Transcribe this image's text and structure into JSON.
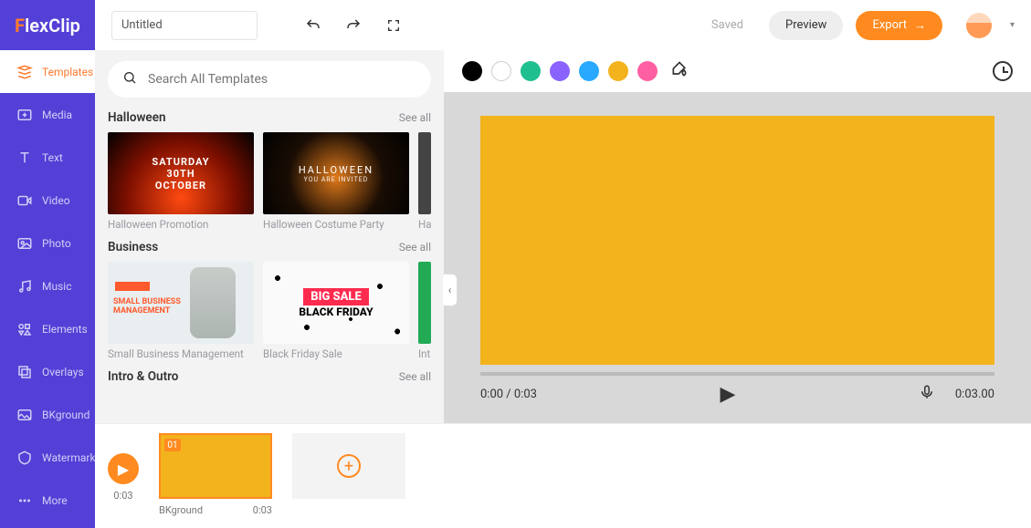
{
  "logo": {
    "f": "F",
    "rest": "lexClip"
  },
  "sidebar": {
    "items": [
      {
        "label": "Templates"
      },
      {
        "label": "Media"
      },
      {
        "label": "Text"
      },
      {
        "label": "Video"
      },
      {
        "label": "Photo"
      },
      {
        "label": "Music"
      },
      {
        "label": "Elements"
      },
      {
        "label": "Overlays"
      },
      {
        "label": "BKground"
      },
      {
        "label": "Watermark"
      },
      {
        "label": "More"
      }
    ]
  },
  "topbar": {
    "title_value": "Untitled",
    "saved_label": "Saved",
    "preview_label": "Preview",
    "export_label": "Export"
  },
  "search": {
    "placeholder": "Search All Templates"
  },
  "sections": {
    "see_all": "See all",
    "halloween": {
      "title": "Halloween",
      "cards": [
        {
          "label": "Halloween Promotion",
          "line1": "SATURDAY",
          "line2": "30TH",
          "line3": "OCTOBER"
        },
        {
          "label": "Halloween Costume Party",
          "line1": "HALLOWEEN",
          "line2": "YOU ARE INVITED"
        },
        {
          "label": "Ha"
        }
      ]
    },
    "business": {
      "title": "Business",
      "cards": [
        {
          "label": "Small Business Management",
          "line1": "SMALL BUSINESS",
          "line2": "MANAGEMENT"
        },
        {
          "label": "Black Friday Sale",
          "line1": "BIG SALE",
          "line2": "BLACK FRIDAY"
        },
        {
          "label": "Int"
        }
      ]
    },
    "intro": {
      "title": "Intro & Outro"
    }
  },
  "swatches": [
    "#000000",
    "#ffffff",
    "#1fbf8f",
    "#8a63ff",
    "#29a9ff",
    "#f3b31c",
    "#ff5fa2"
  ],
  "player": {
    "time_current": "0:00",
    "time_sep": " / ",
    "time_total": "0:03",
    "duration_display": "0:03.00"
  },
  "timeline": {
    "total": "0:03",
    "clip_num": "01",
    "clip_name": "BKground",
    "clip_dur": "0:03"
  }
}
